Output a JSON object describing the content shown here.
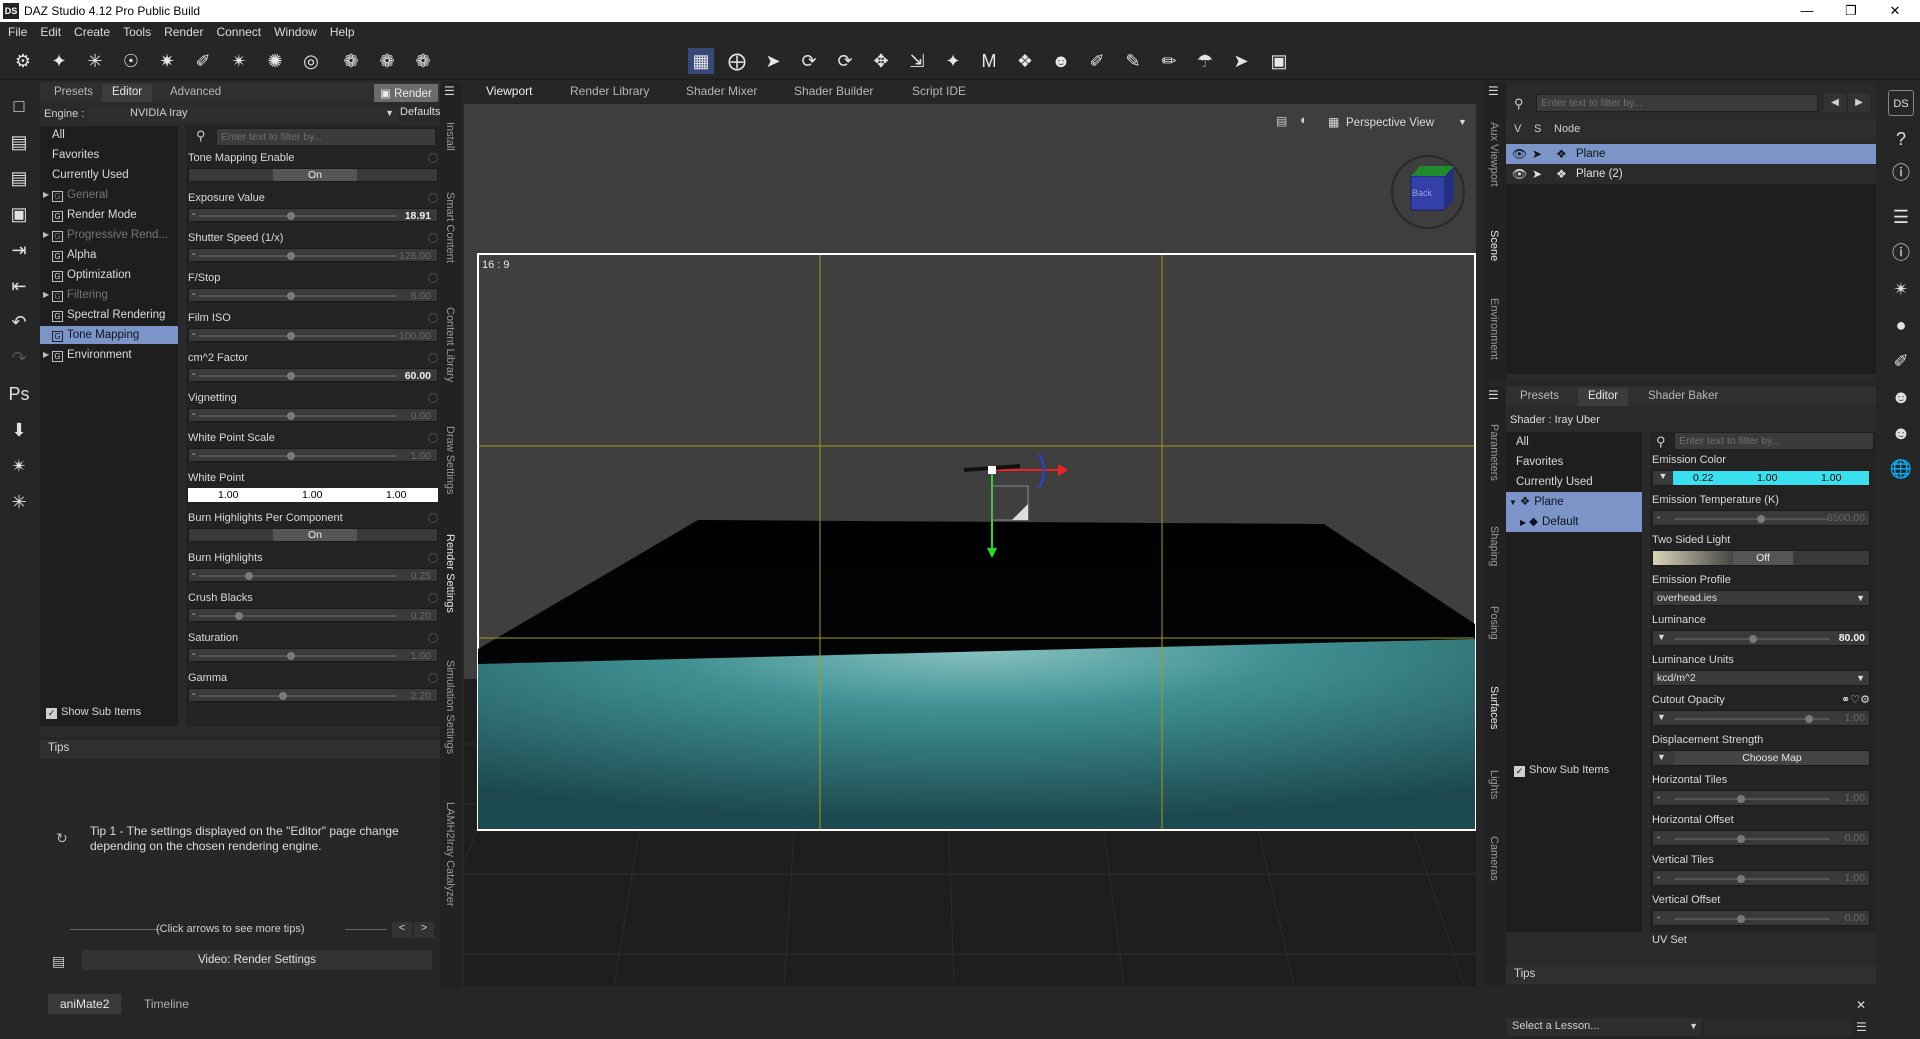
{
  "window": {
    "title": "DAZ Studio 4.12 Pro Public Build",
    "app_icon": "DS",
    "controls": [
      "minimize-icon",
      "maximize-icon",
      "close-icon"
    ]
  },
  "menu": [
    "File",
    "Edit",
    "Create",
    "Tools",
    "Render",
    "Connect",
    "Window",
    "Help"
  ],
  "left_panel": {
    "tabs": [
      "Presets",
      "Editor",
      "Advanced"
    ],
    "active_tab": "Editor",
    "render_button": "Render",
    "engine_label": "Engine :",
    "engine_value": "NVIDIA Iray",
    "defaults_button": "Defaults",
    "filter_placeholder": "Enter text to filter by...",
    "tree": [
      {
        "label": "All"
      },
      {
        "label": "Favorites"
      },
      {
        "label": "Currently Used"
      },
      {
        "label": "General"
      },
      {
        "label": "Render Mode"
      },
      {
        "label": "Progressive Rend..."
      },
      {
        "label": "Alpha"
      },
      {
        "label": "Optimization"
      },
      {
        "label": "Filtering"
      },
      {
        "label": "Spectral Rendering"
      },
      {
        "label": "Tone Mapping"
      },
      {
        "label": "Environment"
      }
    ],
    "properties": [
      {
        "label": "Tone Mapping Enable",
        "value": "On"
      },
      {
        "label": "Exposure Value",
        "value": "18.91"
      },
      {
        "label": "Shutter Speed (1/x)",
        "value": "128.00"
      },
      {
        "label": "F/Stop",
        "value": "8.00"
      },
      {
        "label": "Film ISO",
        "value": "100.00"
      },
      {
        "label": "cm^2 Factor",
        "value": "60.00"
      },
      {
        "label": "Vignetting",
        "value": "0.00"
      },
      {
        "label": "White Point Scale",
        "value": "1.00"
      },
      {
        "label": "White Point",
        "values": [
          "1.00",
          "1.00",
          "1.00"
        ]
      },
      {
        "label": "Burn Highlights Per Component",
        "value": "On"
      },
      {
        "label": "Burn Highlights",
        "value": "0.25"
      },
      {
        "label": "Crush Blacks",
        "value": "0.20"
      },
      {
        "label": "Saturation",
        "value": "1.00"
      },
      {
        "label": "Gamma",
        "value": "2.20"
      }
    ],
    "show_sub_items": "Show Sub Items"
  },
  "tips": {
    "header": "Tips",
    "tip_number": "Tip 1",
    "tip_text": " - The settings displayed on the \"Editor\" page change depending on the chosen rendering engine.",
    "nav_hint": "(Click arrows to see more tips)",
    "prev": "<",
    "next": ">",
    "video_button": "Video: Render Settings"
  },
  "left_side_tabs": [
    "Install",
    "Smart Content",
    "Content Library",
    "Draw Settings",
    "Render Settings",
    "Simulation Settings",
    "LAMH2Iray Catalyzer"
  ],
  "viewport": {
    "tabs": [
      "Viewport",
      "Render Library",
      "Shader Mixer",
      "Shader Builder",
      "Script IDE"
    ],
    "active_tab": "Viewport",
    "view_name": "Perspective View",
    "aspect_label": "16 : 9",
    "cube_face": "Back"
  },
  "right_side_tabs_top": [
    "Aux Viewport",
    "Scene",
    "Environment"
  ],
  "right_side_tabs_bottom": [
    "Parameters",
    "Shaping",
    "Posing",
    "Surfaces",
    "Lights",
    "Cameras"
  ],
  "scene": {
    "filter_placeholder": "Enter text to filter by...",
    "col_v": "V",
    "col_s": "S",
    "col_node": "Node",
    "nodes": [
      "Plane",
      "Plane (2)"
    ]
  },
  "surfaces": {
    "tabs": [
      "Presets",
      "Editor",
      "Shader Baker"
    ],
    "active_tab": "Editor",
    "shader_label": "Shader : Iray Uber",
    "filter_placeholder": "Enter text to filter by...",
    "tree": [
      "All",
      "Favorites",
      "Currently Used",
      "Plane",
      "Default"
    ],
    "properties": [
      {
        "label": "Emission Color",
        "values": [
          "0.22",
          "1.00",
          "1.00"
        ]
      },
      {
        "label": "Emission Temperature (K)",
        "value": "6500.00"
      },
      {
        "label": "Two Sided Light",
        "value": "Off"
      },
      {
        "label": "Emission Profile",
        "value": "overhead.ies"
      },
      {
        "label": "Luminance",
        "value": "80.00"
      },
      {
        "label": "Luminance Units",
        "value": "kcd/m^2"
      },
      {
        "label": "Cutout Opacity",
        "value": "1.00"
      },
      {
        "label": "Displacement Strength",
        "value": "Choose Map"
      },
      {
        "label": "Horizontal Tiles",
        "value": "1.00"
      },
      {
        "label": "Horizontal Offset",
        "value": "0.00"
      },
      {
        "label": "Vertical Tiles",
        "value": "1.00"
      },
      {
        "label": "Vertical Offset",
        "value": "0.00"
      },
      {
        "label": "UV Set",
        "value": ""
      }
    ],
    "show_sub_items": "Show Sub Items",
    "tips_header": "Tips"
  },
  "bottom": {
    "tabs": [
      "aniMate2",
      "Timeline"
    ],
    "active_tab": "aniMate2",
    "lesson_select": "Select a Lesson..."
  },
  "colors": {
    "selection": "#7b95c9",
    "emission_color": "#38e0f0",
    "floor_glow": "#4aa8aa",
    "guide_line": "#a59a18"
  }
}
